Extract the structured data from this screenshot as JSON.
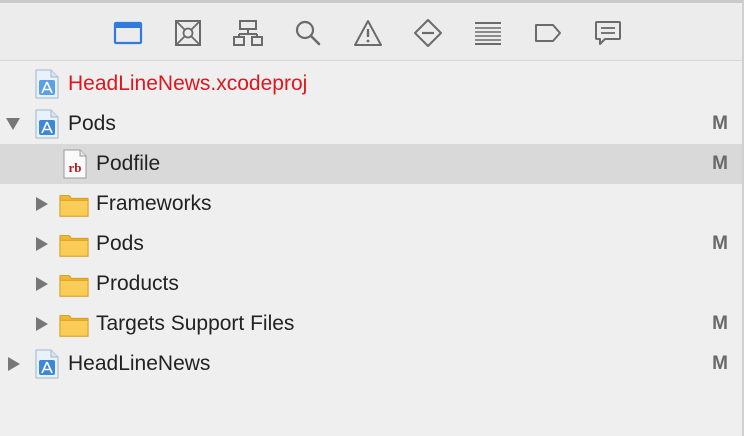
{
  "toolbar": {
    "icons": [
      "project-navigator-icon",
      "source-control-icon",
      "symbol-navigator-icon",
      "find-icon",
      "issue-icon",
      "test-icon",
      "debug-icon",
      "breakpoint-icon",
      "report-icon"
    ],
    "active_color": "#2f7be0",
    "icon_color": "#6b6b6b"
  },
  "tree": {
    "items": [
      {
        "label": "HeadLineNews.xcodeproj",
        "status": "",
        "icon": "xcodeproj-icon",
        "disclosure": "none",
        "label_color": "#e0161d"
      },
      {
        "label": "Pods",
        "status": "M",
        "icon": "xcodeproj-icon",
        "disclosure": "expanded"
      },
      {
        "label": "Podfile",
        "status": "M",
        "icon": "ruby-file-icon",
        "disclosure": "none",
        "selected": true
      },
      {
        "label": "Frameworks",
        "status": "",
        "icon": "folder-icon",
        "disclosure": "collapsed"
      },
      {
        "label": "Pods",
        "status": "M",
        "icon": "folder-icon",
        "disclosure": "collapsed"
      },
      {
        "label": "Products",
        "status": "",
        "icon": "folder-icon",
        "disclosure": "collapsed"
      },
      {
        "label": "Targets Support Files",
        "status": "M",
        "icon": "folder-icon",
        "disclosure": "collapsed"
      },
      {
        "label": "HeadLineNews",
        "status": "M",
        "icon": "xcodeproj-icon",
        "disclosure": "collapsed"
      }
    ],
    "selected_bg": "#d9d9d9",
    "folder_color": "#f5c542",
    "ruby_color": "#b31d1d"
  }
}
